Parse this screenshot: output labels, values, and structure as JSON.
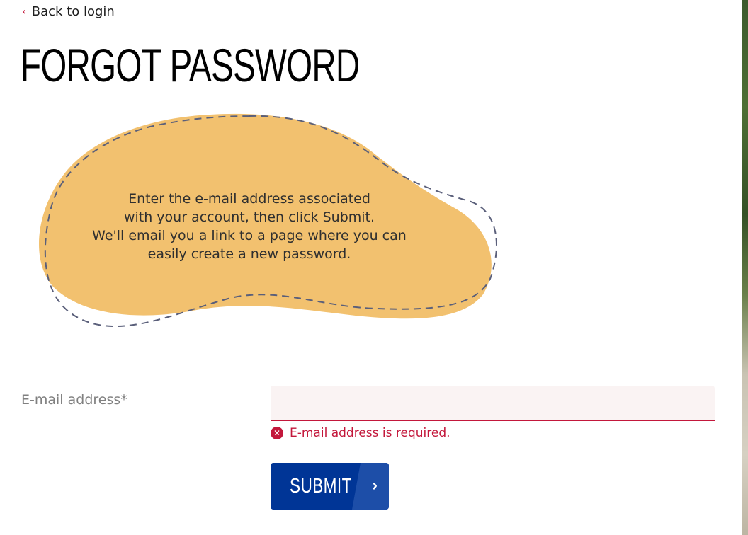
{
  "nav": {
    "back_label": "Back to login",
    "back_icon": "chevron-left-icon"
  },
  "page": {
    "title": "FORGOT PASSWORD"
  },
  "intro": {
    "lines": [
      "Enter the e-mail address associated",
      "with your account, then click Submit.",
      "We'll email you a link to a page where you can",
      "easily create a new password."
    ],
    "blob_color": "#f2c16f",
    "dash_color": "#5a5f7a"
  },
  "form": {
    "email_label": "E-mail address*",
    "email_value": "",
    "email_placeholder": "",
    "error_message": "E-mail address is required.",
    "error_icon": "error-circle-x-icon",
    "submit_label": "SUBMIT",
    "submit_icon": "chevron-right-icon"
  },
  "colors": {
    "accent": "#c3173b",
    "button": "#003596",
    "button_stripe": "#1d4ea8"
  }
}
